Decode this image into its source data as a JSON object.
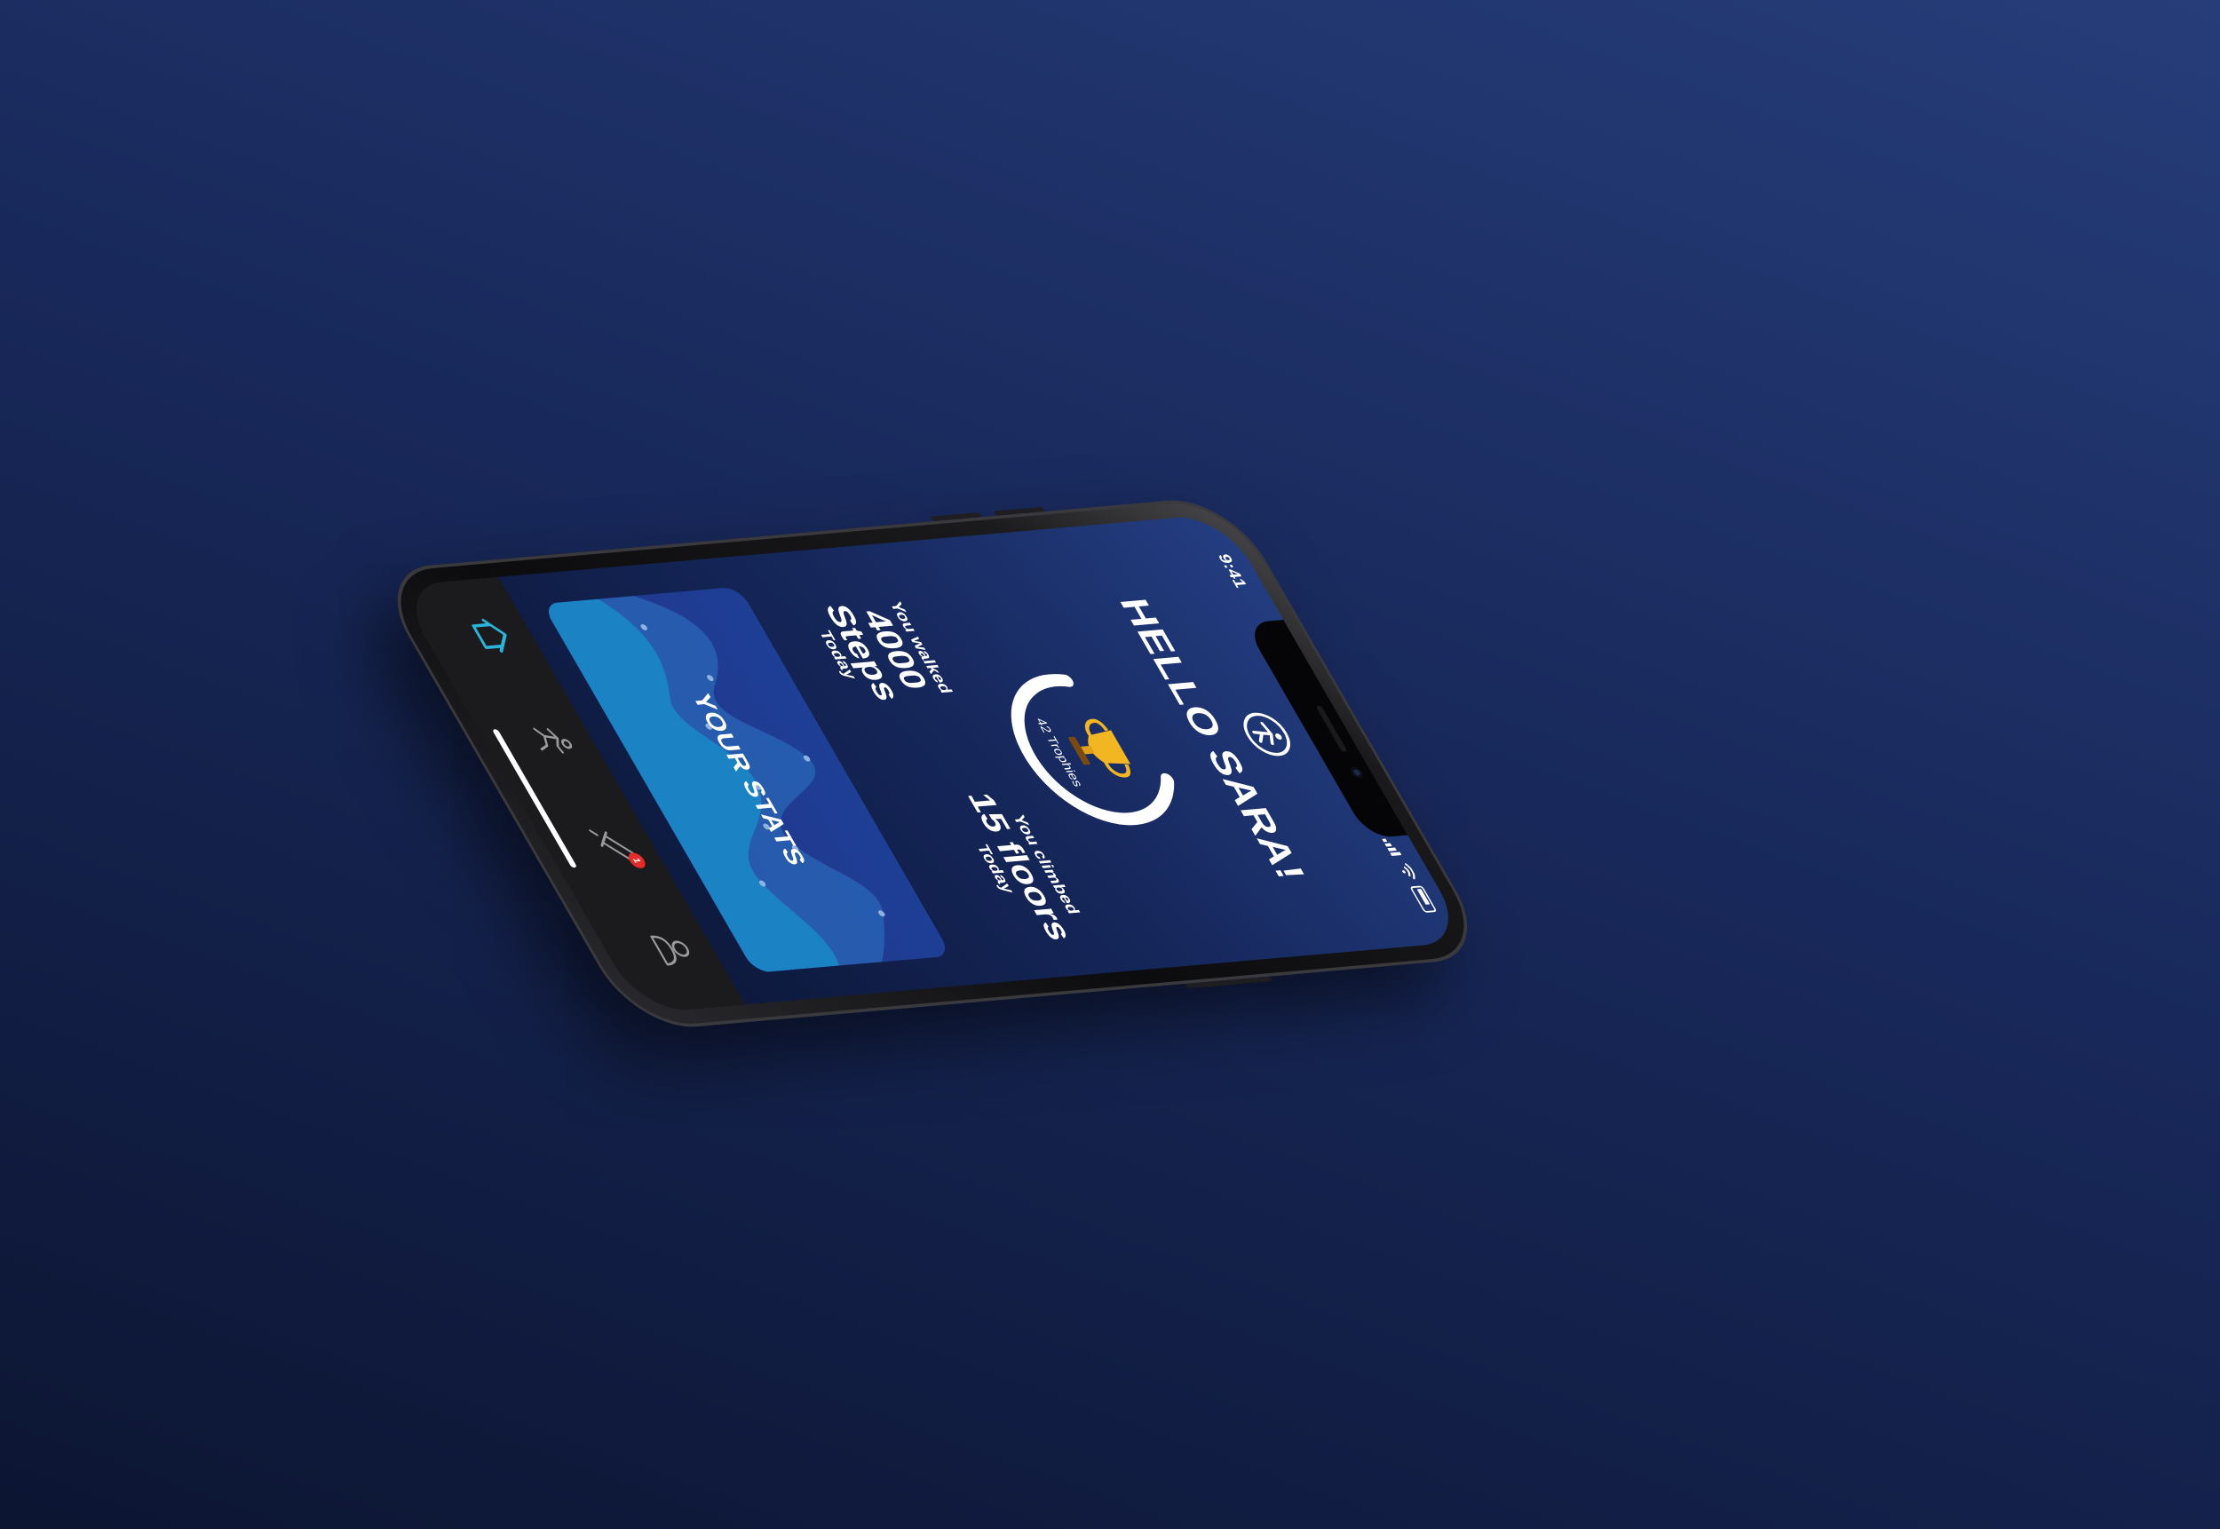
{
  "status_bar": {
    "time": "9:41"
  },
  "header": {
    "greeting": "HELLO SARA!",
    "logo_icon": "running-person-logo-icon"
  },
  "trophies": {
    "label": "42 Trophies",
    "icon": "trophy-icon",
    "progress": 0.7
  },
  "steps": {
    "prefix": "You walked",
    "value": "4000",
    "unit": "Steps",
    "suffix": "Today"
  },
  "floors": {
    "prefix": "You climbed",
    "value": "15 floors",
    "suffix": "Today"
  },
  "stats_card": {
    "title": "YOUR STATS"
  },
  "tabbar": {
    "items": [
      {
        "name": "home",
        "icon": "home-icon",
        "active": true
      },
      {
        "name": "activity",
        "icon": "running-icon",
        "active": false
      },
      {
        "name": "challenges",
        "icon": "sword-icon",
        "active": false,
        "badge": "1"
      },
      {
        "name": "profile",
        "icon": "user-icon",
        "active": false
      }
    ]
  },
  "colors": {
    "accent": "#2bb3d9",
    "badge": "#e52b2b",
    "trophy": "#f2b622",
    "ring": "#ffffff"
  }
}
